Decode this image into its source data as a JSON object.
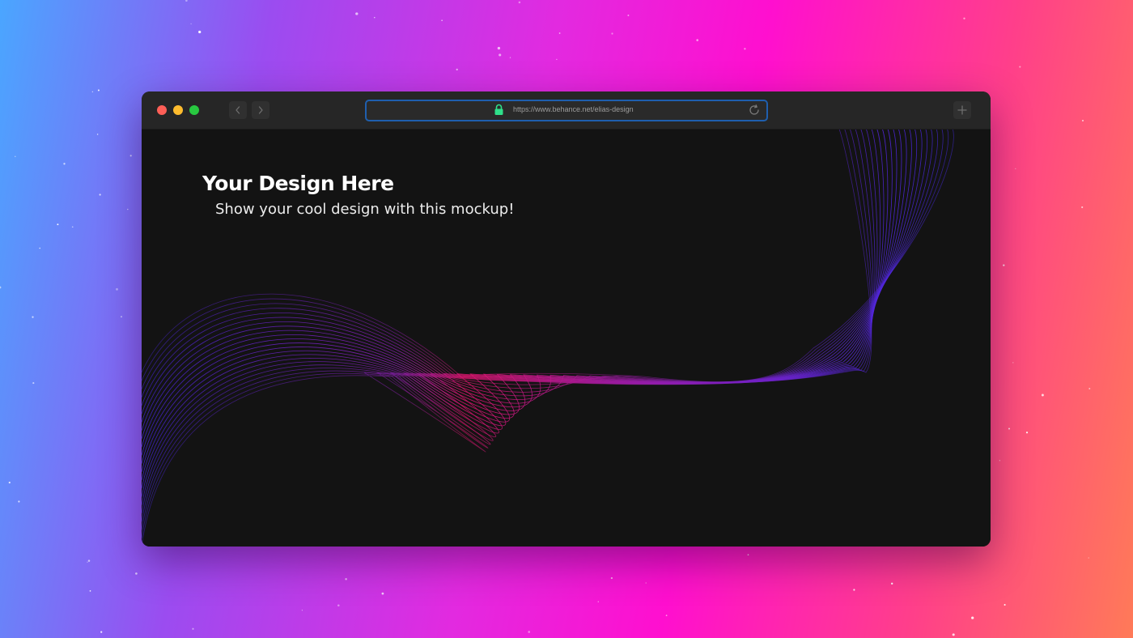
{
  "browser": {
    "url": "https://www.behance.net/elias-design",
    "buttons": {
      "close": "close",
      "minimize": "minimize",
      "zoom": "zoom",
      "back": "chevron-left-icon",
      "forward": "chevron-right-icon",
      "new_tab": "plus-icon"
    },
    "icons": {
      "secure": "lock-icon",
      "reload": "reload-icon"
    }
  },
  "page": {
    "headline": "Your Design Here",
    "subheadline": "Show your cool design with this mockup!"
  },
  "colors": {
    "traffic_red": "#fe5f57",
    "traffic_yellow": "#febc2e",
    "traffic_green": "#28c840",
    "url_focus_ring": "#1f5fae",
    "lock": "#2fe08a",
    "wave_start": "#4b1fd1",
    "wave_mid": "#d4147a",
    "wave_end": "#3a2ae0"
  }
}
